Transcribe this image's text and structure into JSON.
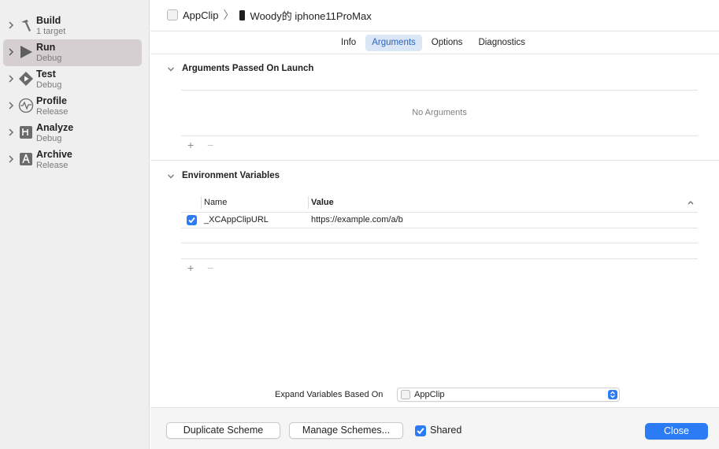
{
  "sidebar": {
    "items": [
      {
        "title": "Build",
        "subtitle": "1 target",
        "icon": "hammer-icon"
      },
      {
        "title": "Run",
        "subtitle": "Debug",
        "icon": "play-icon"
      },
      {
        "title": "Test",
        "subtitle": "Debug",
        "icon": "test-diamond-icon"
      },
      {
        "title": "Profile",
        "subtitle": "Release",
        "icon": "waveform-icon"
      },
      {
        "title": "Analyze",
        "subtitle": "Debug",
        "icon": "analyze-icon"
      },
      {
        "title": "Archive",
        "subtitle": "Release",
        "icon": "archive-icon"
      }
    ],
    "selected_index": 1
  },
  "breadcrumb": {
    "scheme": "AppClip",
    "device": "Woody的 iphone11ProMax"
  },
  "tabs": [
    "Info",
    "Arguments",
    "Options",
    "Diagnostics"
  ],
  "active_tab": "Arguments",
  "arguments_section": {
    "title": "Arguments Passed On Launch",
    "empty_message": "No Arguments",
    "add": "+",
    "remove": "−"
  },
  "env_section": {
    "title": "Environment Variables",
    "columns": {
      "name": "Name",
      "value": "Value"
    },
    "rows": [
      {
        "enabled": true,
        "name": "_XCAppClipURL",
        "value": "https://example.com/a/b"
      }
    ],
    "add": "+",
    "remove": "−"
  },
  "expand": {
    "label": "Expand Variables Based On",
    "selected": "AppClip"
  },
  "footer": {
    "duplicate": "Duplicate Scheme",
    "manage": "Manage Schemes...",
    "shared": "Shared",
    "shared_checked": true,
    "close": "Close"
  },
  "colors": {
    "accent": "#2a7bf4",
    "selected_row": "#d6cfd1",
    "active_tab_bg": "#dbe7f6"
  }
}
